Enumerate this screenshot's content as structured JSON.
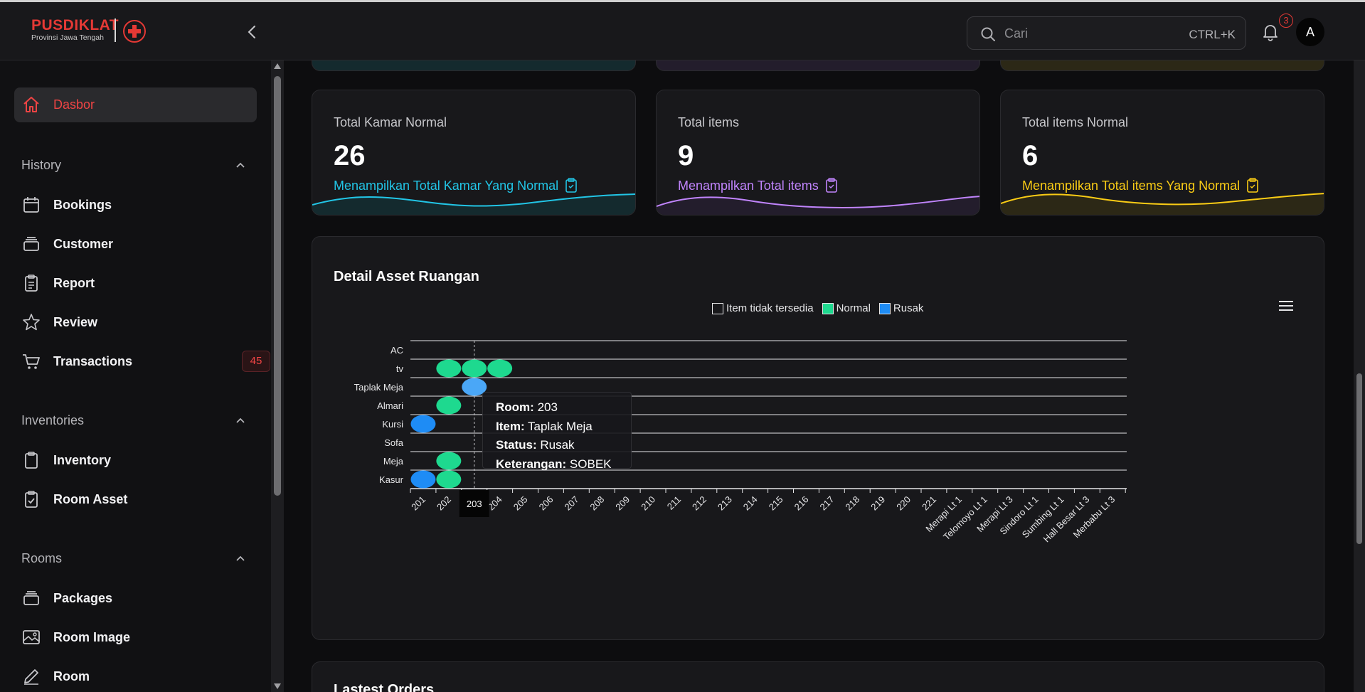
{
  "app": {
    "logo_title": "PUSDIKLAT",
    "logo_subtitle": "Provinsi Jawa Tengah",
    "accent": "#e53935"
  },
  "header": {
    "search_placeholder": "Cari",
    "search_shortcut": "CTRL+K",
    "notification_count": "3",
    "avatar_initial": "A"
  },
  "sidebar": {
    "dashboard_label": "Dasbor",
    "sections": [
      {
        "title": "History",
        "items": [
          {
            "label": "Bookings",
            "icon": "calendar-icon"
          },
          {
            "label": "Customer",
            "icon": "stack-icon"
          },
          {
            "label": "Report",
            "icon": "clipboard-icon"
          },
          {
            "label": "Review",
            "icon": "star-icon"
          },
          {
            "label": "Transactions",
            "icon": "cart-icon",
            "badge": "45"
          }
        ]
      },
      {
        "title": "Inventories",
        "items": [
          {
            "label": "Inventory",
            "icon": "clipboard-icon"
          },
          {
            "label": "Room Asset",
            "icon": "clipboard-check-icon"
          }
        ]
      },
      {
        "title": "Rooms",
        "items": [
          {
            "label": "Packages",
            "icon": "stack-icon"
          },
          {
            "label": "Room Image",
            "icon": "image-icon"
          },
          {
            "label": "Room",
            "icon": "edit-icon"
          }
        ]
      }
    ]
  },
  "stats": [
    {
      "title": "Total Kamar Normal",
      "value": "26",
      "desc": "Menampilkan Total Kamar Yang Normal",
      "color": "#22c5e6",
      "bg": "#142a2e"
    },
    {
      "title": "Total items",
      "value": "9",
      "desc": "Menampilkan Total items",
      "color": "#c084fc",
      "bg": "#231d2c"
    },
    {
      "title": "Total items Normal",
      "value": "6",
      "desc": "Menampilkan Total items Yang Normal",
      "color": "#facc15",
      "bg": "#2c2816"
    }
  ],
  "chart": {
    "title": "Detail Asset Ruangan",
    "legend": [
      "Item tidak tersedia",
      "Normal",
      "Rusak"
    ]
  },
  "chart_data": {
    "type": "scatter",
    "title": "Detail Asset Ruangan",
    "x_categories": [
      "201",
      "202",
      "203",
      "204",
      "205",
      "206",
      "207",
      "208",
      "209",
      "210",
      "211",
      "212",
      "213",
      "214",
      "215",
      "216",
      "217",
      "218",
      "219",
      "220",
      "221",
      "Merapi Lt 1",
      "Telomoyo Lt 1",
      "Merapi Lt 3",
      "Sindoro Lt 1",
      "Sumbing Lt 1",
      "Hall Besar Lt 3",
      "Merbabu Lt 3"
    ],
    "y_categories": [
      "AC",
      "tv",
      "Taplak Meja",
      "Almari",
      "Kursi",
      "Sofa",
      "Meja",
      "Kasur"
    ],
    "series": [
      {
        "name": "Item tidak tersedia",
        "color": "#18181b",
        "points": []
      },
      {
        "name": "Normal",
        "color": "#1ed98f",
        "points": [
          {
            "x": "202",
            "y": "tv"
          },
          {
            "x": "203",
            "y": "tv"
          },
          {
            "x": "204",
            "y": "tv"
          },
          {
            "x": "202",
            "y": "Almari"
          },
          {
            "x": "202",
            "y": "Meja"
          },
          {
            "x": "202",
            "y": "Kasur"
          }
        ]
      },
      {
        "name": "Rusak",
        "color": "#1e8cf5",
        "points": [
          {
            "x": "203",
            "y": "Taplak Meja"
          },
          {
            "x": "201",
            "y": "Kursi"
          },
          {
            "x": "201",
            "y": "Kasur"
          }
        ]
      }
    ],
    "legend_position": "top-center",
    "grid": true
  },
  "tooltip": {
    "room_label": "Room:",
    "room": "203",
    "item_label": "Item:",
    "item": "Taplak Meja",
    "status_label": "Status:",
    "status": "Rusak",
    "ket_label": "Keterangan:",
    "ket": "SOBEK",
    "x_highlight": "203"
  },
  "orders": {
    "title": "Lastest Orders"
  }
}
